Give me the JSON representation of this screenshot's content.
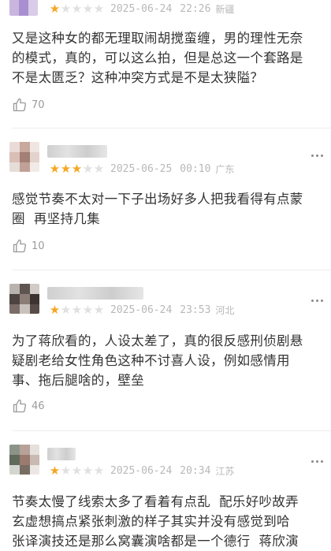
{
  "reviews": [
    {
      "stars": 1,
      "date": "2025-06-24",
      "time": "22:26",
      "region": "新疆",
      "text": "又是这种女的都无理取闹胡搅蛮缠，男的理性无奈\n的模式，真的，可以这么拍，但是总这一个套路是\n不是太匮乏？这种冲突方式是不是太狭隘？",
      "likes": "70"
    },
    {
      "stars": 3,
      "date": "2025-06-25",
      "time": "00:10",
      "region": "广东",
      "text": "感觉节奏不太对一下子出场好多人把我看得有点蒙\n圈  再坚持几集",
      "likes": "10"
    },
    {
      "stars": 1,
      "date": "2025-06-24",
      "time": "23:53",
      "region": "河北",
      "text": "为了蒋欣看的，人设太差了，真的很反感刑侦剧悬\n疑剧老给女性角色这种不讨喜人设，例如感情用\n事、拖后腿啥的，壁垒",
      "likes": "46"
    },
    {
      "stars": 1,
      "date": "2025-06-24",
      "time": "20:34",
      "region": "江苏",
      "text": "节奏太慢了线索太多了看着有点乱  配乐好吵故弄\n玄虚想搞点紧张刺激的样子其实并没有感觉到哈\n张译演技还是那么窝囊演啥都是一个德行  蒋欣演",
      "likes": ""
    }
  ]
}
